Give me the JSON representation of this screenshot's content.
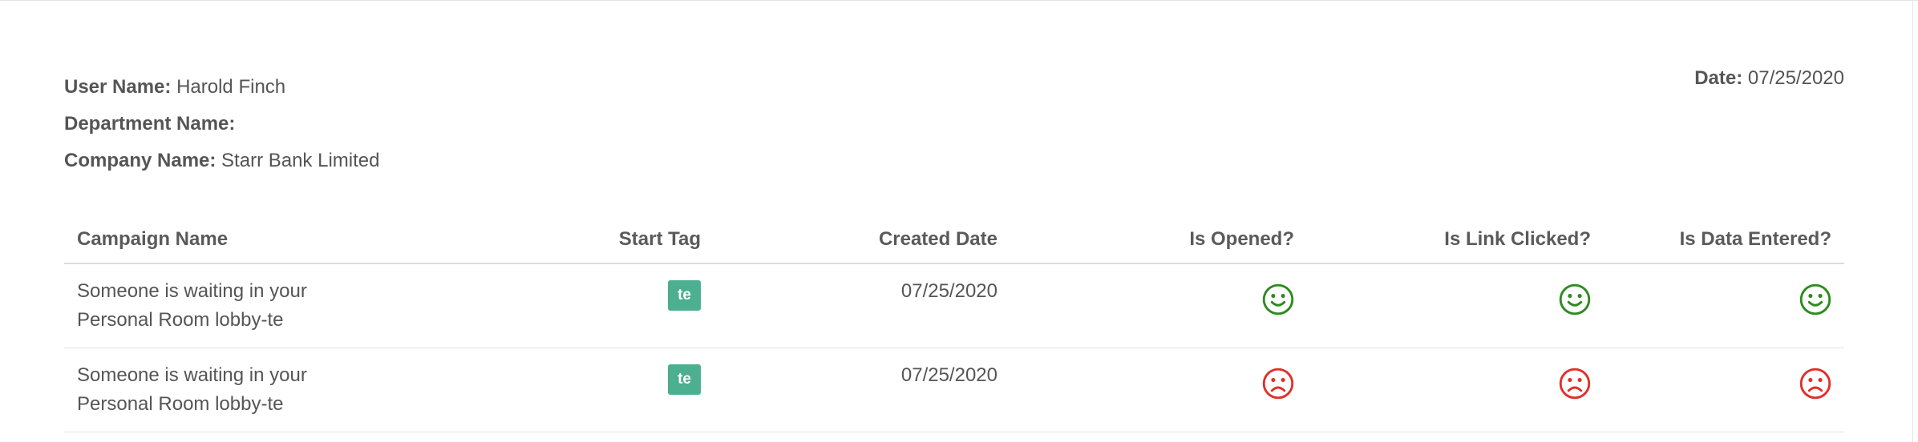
{
  "header": {
    "user_name_label": "User Name:",
    "user_name_value": "Harold Finch",
    "department_label": "Department Name:",
    "department_value": "",
    "company_label": "Company Name:",
    "company_value": "Starr Bank Limited",
    "date_label": "Date:",
    "date_value": "07/25/2020"
  },
  "table": {
    "columns": [
      "Campaign Name",
      "Start Tag",
      "Created Date",
      "Is Opened?",
      "Is Link Clicked?",
      "Is Data Entered?"
    ],
    "rows": [
      {
        "campaign_line1": "Someone is waiting in your",
        "campaign_line2": "Personal Room lobby-te",
        "start_tag": "te",
        "created_date": "07/25/2020",
        "is_opened": "smile-icon",
        "is_link_clicked": "smile-icon",
        "is_data_entered": "smile-icon"
      },
      {
        "campaign_line1": "Someone is waiting in your",
        "campaign_line2": "Personal Room lobby-te",
        "start_tag": "te",
        "created_date": "07/25/2020",
        "is_opened": "frown-icon",
        "is_link_clicked": "frown-icon",
        "is_data_entered": "frown-icon"
      }
    ]
  },
  "colors": {
    "tag_bg": "#4caf8f",
    "positive": "#2e8b1e",
    "negative": "#e0302a"
  }
}
